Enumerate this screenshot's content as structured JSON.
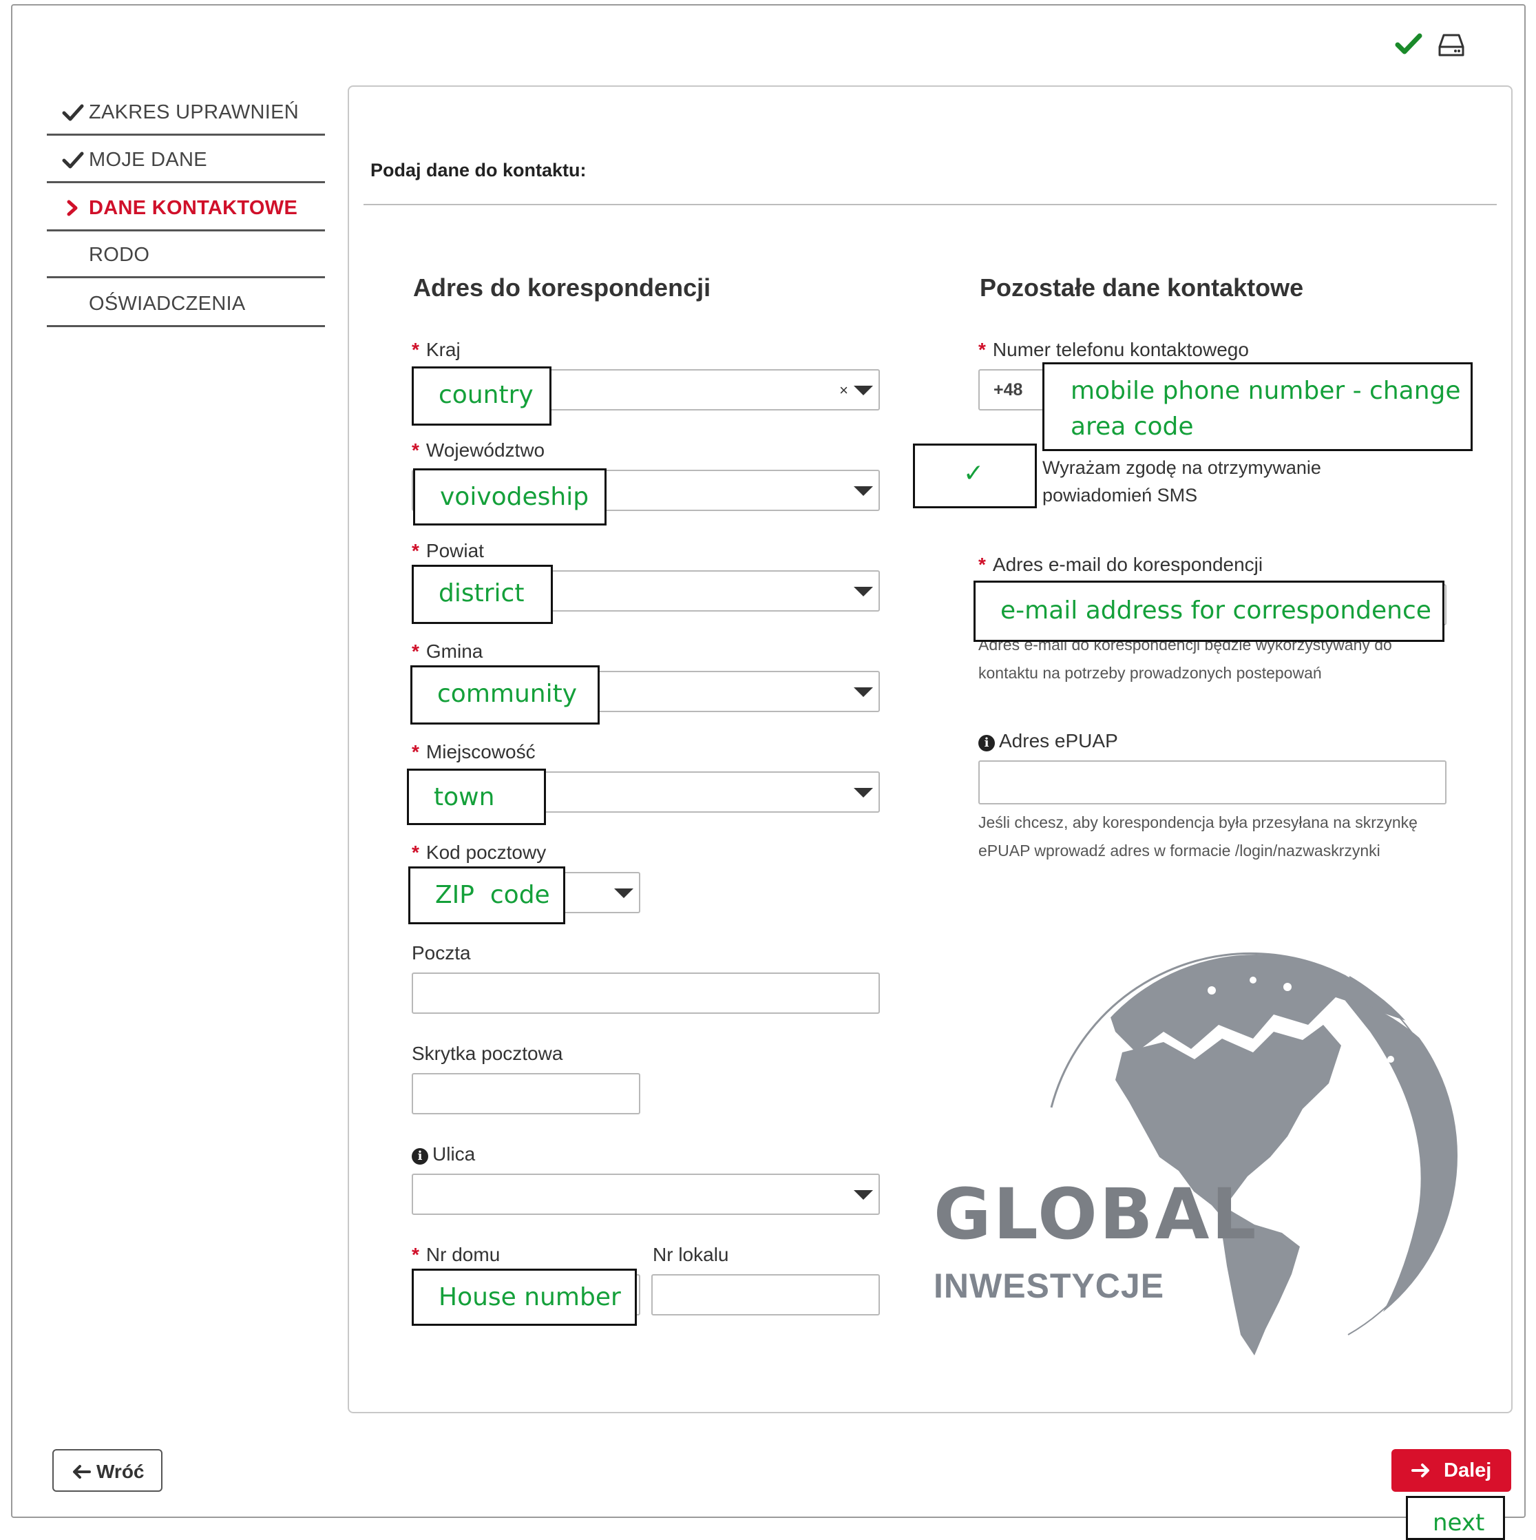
{
  "sidebar": {
    "items": [
      {
        "label": "ZAKRES UPRAWNIEŃ",
        "state": "done"
      },
      {
        "label": "MOJE DANE",
        "state": "done"
      },
      {
        "label": "DANE KONTAKTOWE",
        "state": "active"
      },
      {
        "label": "RODO",
        "state": "pending"
      },
      {
        "label": "OŚWIADCZENIA",
        "state": "pending"
      }
    ]
  },
  "header_icons": [
    "check-icon",
    "drive-icon"
  ],
  "panel": {
    "title": "Podaj dane do kontaktu:",
    "address": {
      "title": "Adres do korespondencji",
      "fields": {
        "kraj": "Kraj",
        "wojewodztwo": "Województwo",
        "powiat": "Powiat",
        "gmina": "Gmina",
        "miejscowosc": "Miejscowość",
        "kod": "Kod pocztowy",
        "poczta": "Poczta",
        "skrytka": "Skrytka pocztowa",
        "ulica": "Ulica",
        "nr_domu": "Nr domu",
        "nr_lokalu": "Nr lokalu"
      },
      "clear_symbol": "×"
    },
    "contact": {
      "title": "Pozostałe dane kontaktowe",
      "phone_label": "Numer telefonu kontaktowego",
      "phone_prefix": "+48",
      "sms_consent_line1": "Wyrażam zgodę na otrzymywanie",
      "sms_consent_line2": "powiadomień SMS",
      "sms_checked": true,
      "email_label": "Adres e-mail do korespondencji",
      "email_hint_line1": "Adres e-mail do korespondencji będzie wykorzystywany do",
      "email_hint_line2": "kontaktu na potrzeby prowadzonych postepowań",
      "epuap_label": "Adres ePUAP",
      "epuap_hint_line1": "Jeśli chcesz, aby korespondencja była przesyłana na skrzynkę",
      "epuap_hint_line2": "ePUAP wprowadź adres w formacie /login/nazwaskrzynki"
    }
  },
  "annotations": {
    "country": "country",
    "voivodeship": "voivodeship",
    "district": "district",
    "community": "community",
    "town": "town",
    "zip": "ZIP  code",
    "house": "House number",
    "phone_line1": "mobile phone number - change",
    "phone_line2": "area code",
    "checkmark": "✓",
    "email": "e-mail address for correspondence",
    "next": "next"
  },
  "logo": {
    "line1": "GLOBAL",
    "line2": "INWESTYCJE"
  },
  "buttons": {
    "back": "Wróć",
    "next": "Dalej"
  },
  "colors": {
    "accent": "#d8102b",
    "annotation_text": "#14a03a",
    "done_check": "#1a8a2a"
  }
}
